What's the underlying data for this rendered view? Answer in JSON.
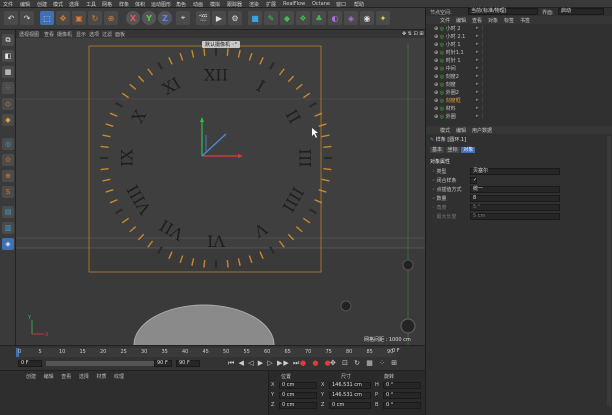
{
  "menubar": {
    "items": [
      "文件",
      "编辑",
      "创建",
      "模式",
      "选择",
      "工具",
      "网格",
      "样条",
      "体积",
      "运动图形",
      "角色",
      "动画",
      "模拟",
      "跟踪器",
      "渲染",
      "扩展",
      "RealFlow",
      "Octane",
      "窗口",
      "帮助"
    ],
    "layout_label": "界面:",
    "layout_value": "启动"
  },
  "viewport": {
    "menu": [
      "透视视图",
      "查看",
      "摄像机",
      "显示",
      "选项",
      "过滤",
      "面板"
    ],
    "camera_label": "默认摄像机 ◦°",
    "grid_spacing": "网格间距 : 1000 cm",
    "clock_numerals": [
      "XII",
      "I",
      "II",
      "III",
      "IIII",
      "V",
      "VI",
      "VII",
      "VIII",
      "IX",
      "X",
      "XI"
    ]
  },
  "timeline": {
    "ticks": [
      "0",
      "5",
      "10",
      "15",
      "20",
      "25",
      "30",
      "35",
      "40",
      "45",
      "50",
      "55",
      "60",
      "65",
      "70",
      "75",
      "80",
      "85",
      "90"
    ],
    "current_frame": "0 F",
    "start_frame": "0 F",
    "end_frame": "90 F",
    "end_frame2": "90 F"
  },
  "bottom": {
    "menu": [
      "创建",
      "编辑",
      "查看",
      "选择",
      "材质",
      "纹理"
    ],
    "headers": [
      "位置",
      "尺寸",
      "旋转"
    ],
    "rows": [
      {
        "axis": "X",
        "pos": "0 cm",
        "size_axis": "X",
        "size": "146.531 cm",
        "rot_axis": "H",
        "rot": "0 °"
      },
      {
        "axis": "Y",
        "pos": "0 cm",
        "size_axis": "Y",
        "size": "146.531 cm",
        "rot_axis": "P",
        "rot": "0 °"
      },
      {
        "axis": "Z",
        "pos": "0 cm",
        "size_axis": "Z",
        "size": "0 cm",
        "rot_axis": "B",
        "rot": "0 °"
      }
    ]
  },
  "right": {
    "top_label": "节点空间:",
    "top_value": "当前(标准/物理)",
    "layout_label": "界面:",
    "layout_value": "启动",
    "om_menu": [
      "文件",
      "编辑",
      "查看",
      "对象",
      "标签",
      "书签"
    ],
    "tree": [
      "小时 2",
      "小时 2.1",
      "小时 1",
      "时针1.1",
      "时针 1",
      "中间",
      "刻度2",
      "刻度",
      "外圈2",
      "刻度框",
      "材料",
      "外圈"
    ],
    "attr_menu": [
      "模式",
      "编辑",
      "用户数据"
    ],
    "object_title": "样条 [圆环.1]",
    "attr_tabs": [
      "基本",
      "坐标",
      "对象"
    ],
    "section": "对象属性",
    "props": [
      {
        "label": "类型",
        "value": "贝塞尔"
      },
      {
        "label": "闭合样条",
        "value": "✓"
      },
      {
        "label": "点插值方式",
        "value": "统一"
      },
      {
        "label": "数量",
        "value": "8"
      },
      {
        "label": "角度",
        "value": "5 °"
      },
      {
        "label": "最大长度",
        "value": "5 cm"
      }
    ]
  },
  "colors": {
    "accent_blue": "#3f6fb5",
    "tick_orange": "#c8892e",
    "axis_green": "#2fbf4f",
    "axis_red": "#e03a3a",
    "axis_blue": "#4a8de0"
  }
}
